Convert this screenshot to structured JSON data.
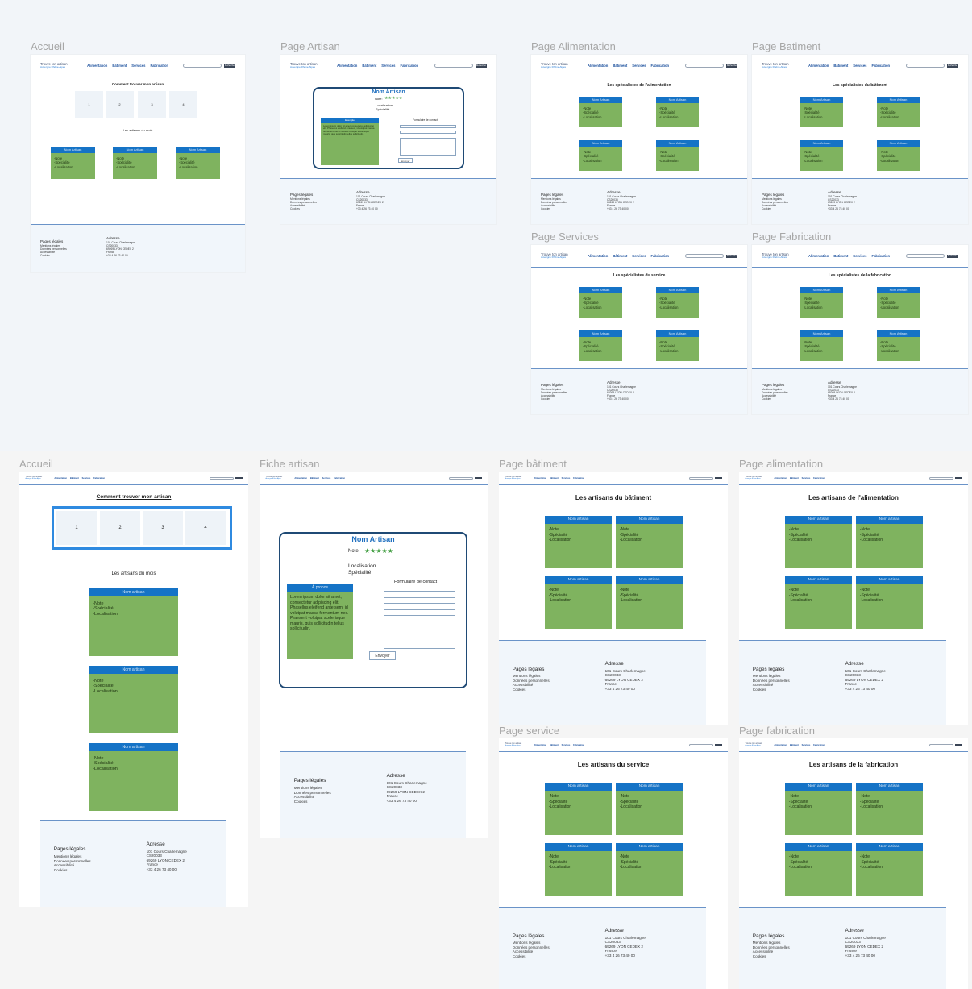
{
  "labels": {
    "top": [
      "Accueil",
      "Page Artisan",
      "Page Alimentation",
      "Page Batiment",
      "Page Services",
      "Page Fabrication"
    ],
    "bottom": [
      "Accueil",
      "Fiche artisan",
      "Page bâtiment",
      "Page alimentation",
      "Page service",
      "Page fabrication"
    ]
  },
  "header": {
    "logo": "Trouve ton artisan",
    "logo_sub": "Auvergne Rhône-Alpes",
    "nav": [
      "Alimentation",
      "Bâtiment",
      "Services",
      "Fabrication"
    ],
    "search_btn": "Rechercher"
  },
  "home": {
    "title": "Comment trouver mon artisan",
    "steps": [
      "1",
      "2",
      "3",
      "4"
    ],
    "month_title": "Les artisans du mois",
    "card_title": "Nom Artisan",
    "card_title_lower": "Nom artisan",
    "card_text": "-Note\n-Spécialité\n-Localisation"
  },
  "artisan": {
    "name": "Nom Artisan",
    "note_label": "Note:",
    "stars": "★★★★★",
    "localisation": "Localisation",
    "specialite": "Spécialité",
    "about_title": "À propos",
    "about_title_small": "Exemple",
    "lorem": "Lorem ipsum dolor sit amet, consectetur adipiscing elit. Phasellus eleifend ante sem, id volutpat massa fermentum nec. Praesent volutpat scelerisque mauris, quis sollicitudin tellus sollicitudin.",
    "form_title": "Formulaire de contact",
    "send": "Envoyer"
  },
  "category_titles_top": [
    "Les spécialistes de l'alimentation",
    "Les spécialistes du bâtiment",
    "Les spécialistes du service",
    "Les spécialistes de la fabrication"
  ],
  "category_titles_bottom": [
    "Les artisans du bâtiment",
    "Les artisans de l'alimentation",
    "Les artisans du service",
    "Les artisans de la fabrication"
  ],
  "footer": {
    "legal_title": "Pages légales",
    "legal_items": "Mentions légales\nDonnées personnelles\nAccessibilité\nCookies",
    "address_title": "Adresse",
    "address": "101 Cours Charlemagne\nCS20033\n69269 LYON CEDEX 2\nFrance\n+33 4 26 73 40 00"
  },
  "colors": {
    "card_green": "#7fb35f",
    "card_bar": "#1573c6",
    "nav_blue": "#1a4f9c",
    "frame_border": "#2f8ae0",
    "profile_border": "#1f4a75"
  }
}
